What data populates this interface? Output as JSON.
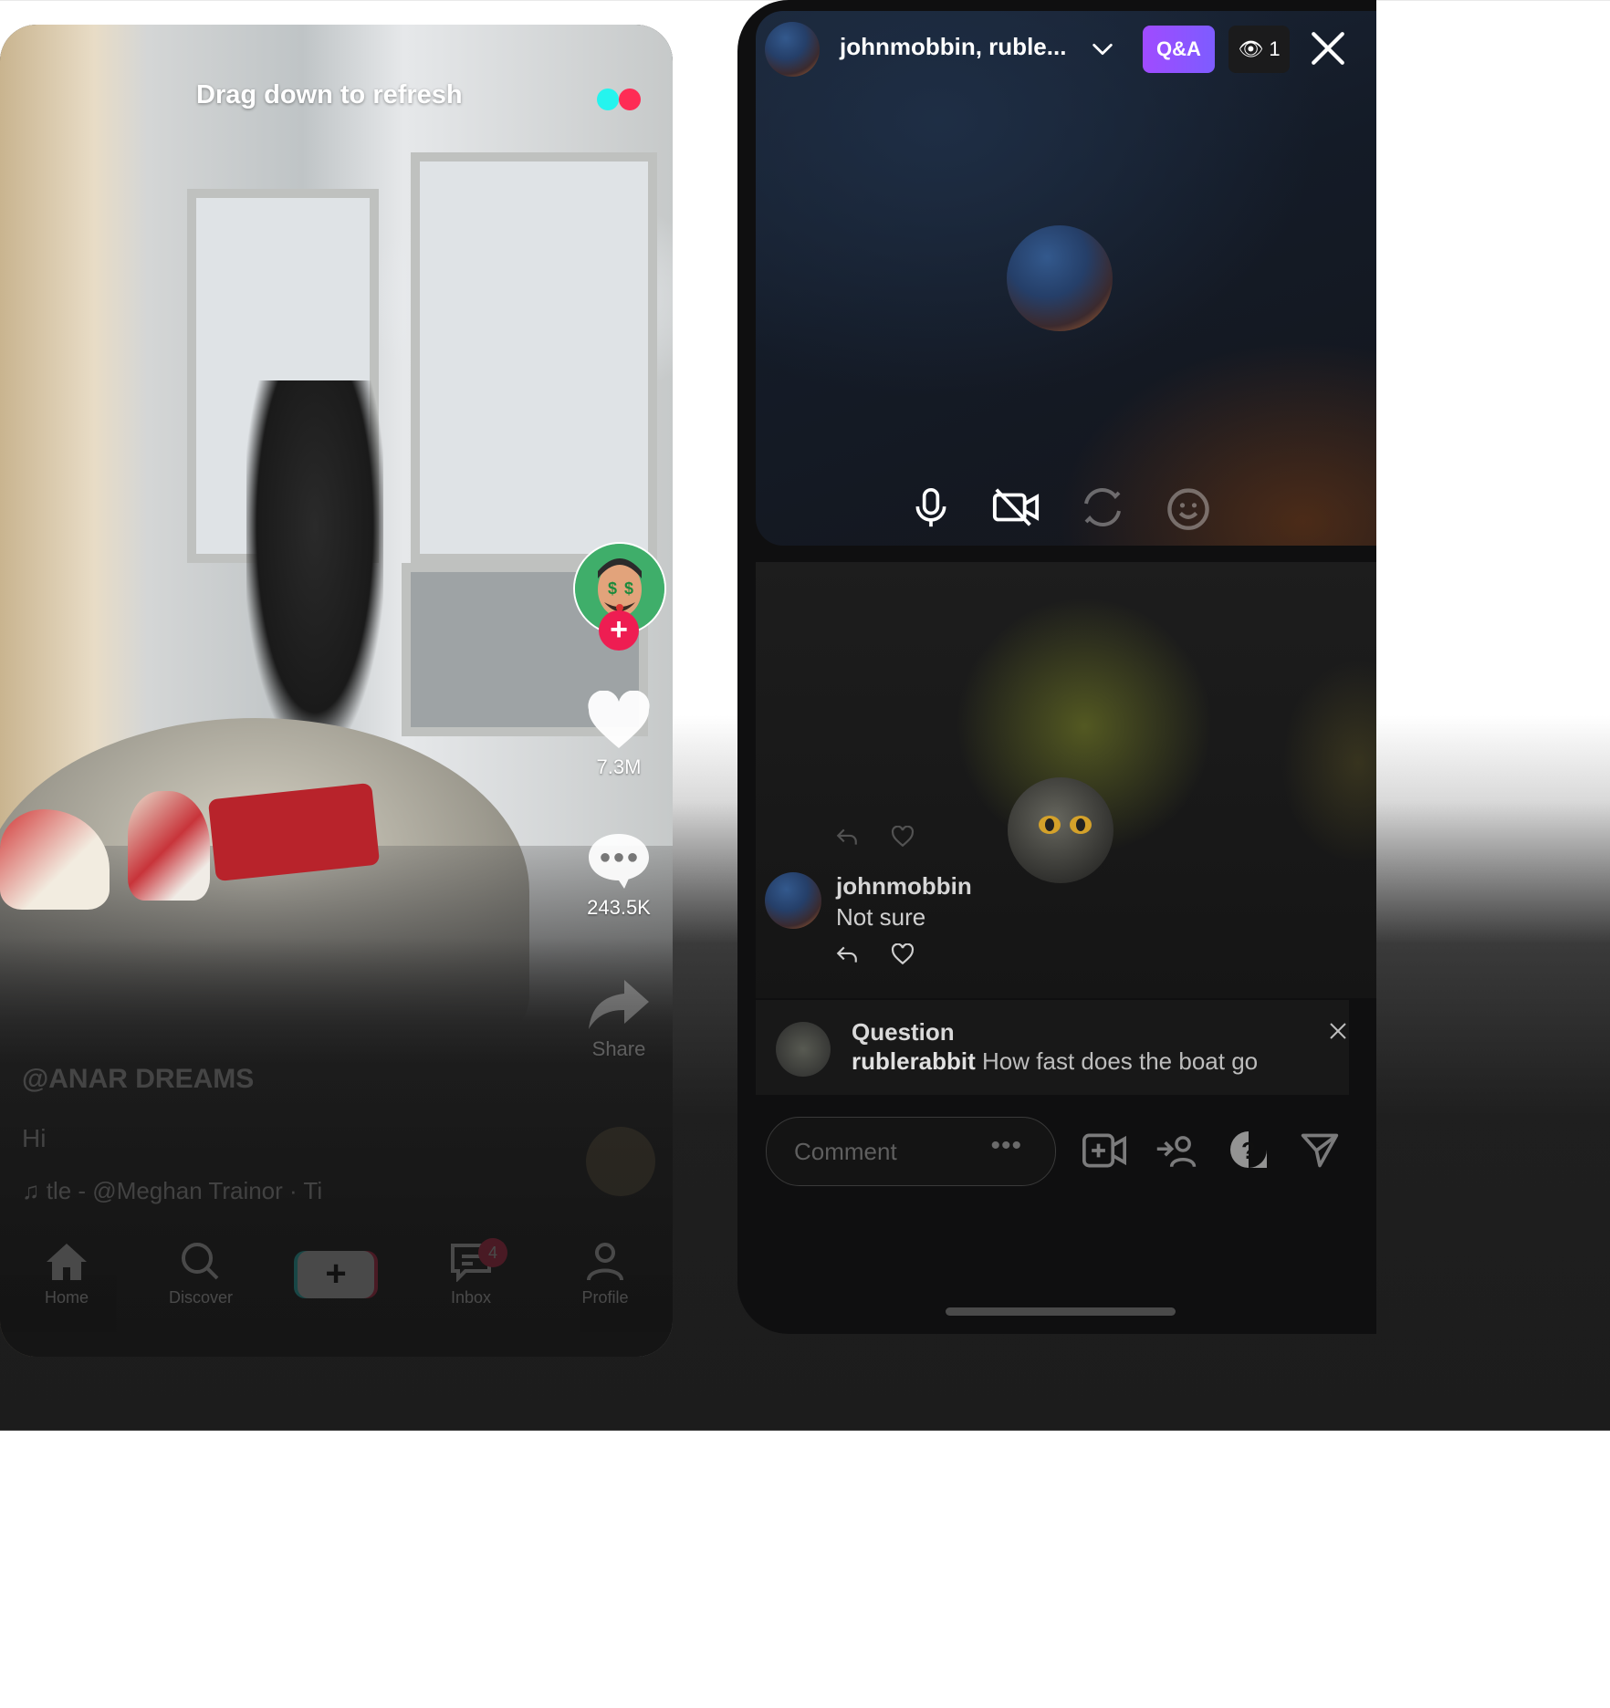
{
  "left_feed": {
    "refresh_hint": "Drag down to refresh",
    "loader_colors": [
      "#25f4ee",
      "#fe2c55"
    ],
    "likes": "7.3M",
    "comments": "243.5K",
    "share_label": "Share",
    "caption_user": "@ANAR DREAMS",
    "caption_text": "Hi",
    "music": "tle - @Meghan Trainor · Ti",
    "nav": {
      "home": "Home",
      "discover": "Discover",
      "inbox": "Inbox",
      "inbox_badge": "4",
      "profile": "Profile",
      "create_symbol": "+"
    },
    "follow_symbol": "+"
  },
  "live_panel": {
    "participants": "johnmobbin, ruble...",
    "qa_label": "Q&A",
    "viewer_count": "1",
    "comment": {
      "user": "johnmobbin",
      "text": "Not sure"
    },
    "question": {
      "title": "Question",
      "user": "rublerabbit",
      "text": "How fast does the boat go"
    },
    "comment_placeholder": "Comment",
    "comment_more": "•••",
    "controls": [
      "mic-icon",
      "camera-off-icon",
      "flip-camera-icon",
      "effects-icon"
    ],
    "actions": [
      "add-video-icon",
      "invite-icon",
      "question-icon",
      "send-icon"
    ]
  }
}
